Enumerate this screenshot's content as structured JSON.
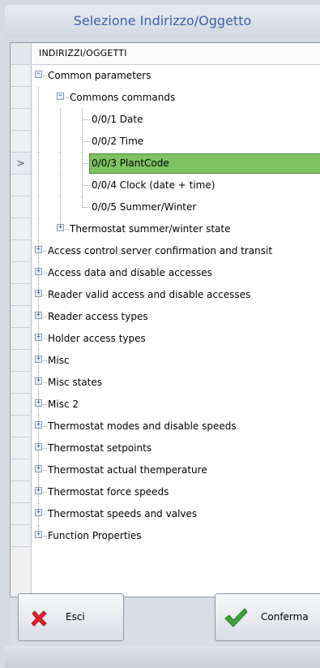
{
  "window": {
    "title": "Selezione Indirizzo/Oggetto"
  },
  "grid": {
    "column_header": "INDIRIZZI/OGGETTI",
    "selected_row_marker": ">",
    "tree": {
      "common_parameters": "Common parameters",
      "commons_commands": "Commons commands",
      "items": [
        "0/0/1 Date",
        "0/0/2 Time",
        "0/0/3 PlantCode",
        "0/0/4 Clock (date + time)",
        "0/0/5 Summer/Winter"
      ],
      "thermostat_summer_winter": "Thermostat summer/winter state",
      "groups": [
        "Access control server confirmation and transit",
        "Access data and disable accesses",
        "Reader valid access and disable accesses",
        "Reader access types",
        "Holder access types",
        "Misc",
        "Misc states",
        "Misc 2",
        "Thermostat modes and disable speeds",
        "Thermostat setpoints",
        "Thermostat actual themperature",
        "Thermostat force speeds",
        "Thermostat speeds and valves",
        "Function Properties"
      ]
    }
  },
  "buttons": {
    "exit": "Esci",
    "confirm": "Conferma"
  },
  "colors": {
    "selection": "#7ec262",
    "title": "#3d62a8",
    "exit_icon": "#e8202a",
    "confirm_icon": "#3aa53a"
  },
  "icons": {
    "collapse": "minus-box-icon",
    "expand": "plus-box-icon",
    "exit": "red-x-icon",
    "confirm": "green-check-icon"
  }
}
